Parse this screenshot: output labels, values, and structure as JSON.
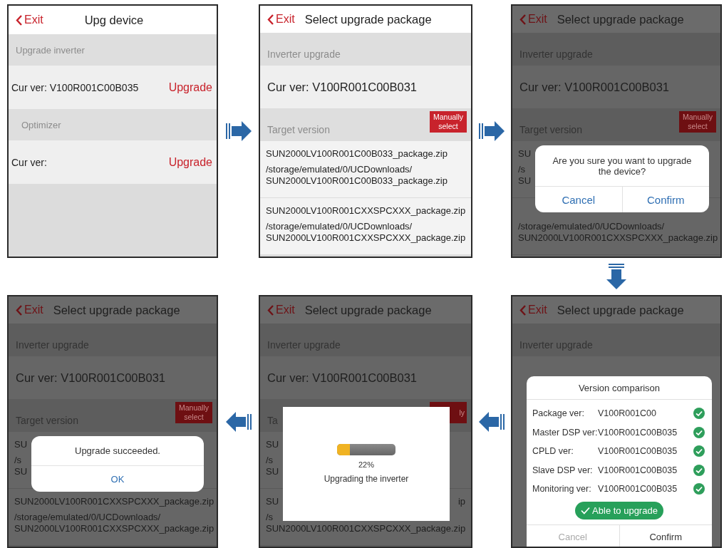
{
  "screens": [
    {
      "kind": "device",
      "dimmed": false,
      "header": {
        "back": "Exit",
        "title": "Upg device"
      },
      "items": [
        {
          "kind": "section",
          "label": "Upgrade inverter"
        },
        {
          "kind": "row",
          "text": "Cur ver: V100R001C00B035",
          "action": "Upgrade"
        },
        {
          "kind": "section",
          "label": "Optimizer",
          "indent": true
        },
        {
          "kind": "row",
          "text": "Cur ver:",
          "action": "Upgrade"
        }
      ]
    },
    {
      "kind": "package",
      "dimmed": false,
      "header": {
        "back": "Exit",
        "title": "Select upgrade package"
      },
      "items": [
        {
          "kind": "section",
          "label": "Inverter upgrade"
        },
        {
          "kind": "row",
          "text": "Cur ver:  V100R001C00B031"
        },
        {
          "kind": "section",
          "label": "Target version",
          "button": {
            "label": "Manually select"
          }
        },
        {
          "kind": "package",
          "name": "SUN2000LV100R001C00B033_package.zip",
          "path_lines": [
            "/storage/emulated/0/UCDownloads/",
            "SUN2000LV100R001C00B033_package.zip"
          ]
        },
        {
          "kind": "package",
          "name": "SUN2000LV100R001CXXSPCXXX_package.zip",
          "path_lines": [
            "/storage/emulated/0/UCDownloads/",
            "SUN2000LV100R001CXXSPCXXX_package.zip"
          ]
        }
      ]
    },
    {
      "kind": "package",
      "dimmed": true,
      "header": {
        "back": "Exit",
        "title": "Select upgrade package"
      },
      "items": [
        {
          "kind": "section",
          "label": "Inverter upgrade"
        },
        {
          "kind": "row",
          "text": "Cur ver:  V100R001C00B031"
        },
        {
          "kind": "section",
          "label": "Target version",
          "button": {
            "label": "Manually select"
          }
        },
        {
          "kind": "package",
          "name": "SU",
          "path_lines": [
            "/s",
            "SU"
          ]
        },
        {
          "kind": "package",
          "path_lines": [
            "/storage/emulated/0/UCDownloads/",
            "SUN2000LV100R001CXXSPCXXX_package.zip"
          ]
        }
      ],
      "dialog": {
        "kind": "confirm",
        "message": "Are you sure you want to upgrade the device?",
        "buttons": [
          {
            "label": "Cancel"
          },
          {
            "label": "Confirm"
          }
        ]
      }
    },
    {
      "kind": "package",
      "dimmed": true,
      "header": {
        "back": "Exit",
        "title": "Select upgrade package"
      },
      "items": [
        {
          "kind": "section",
          "label": "Inverter upgrade"
        },
        {
          "kind": "row",
          "text": "Cur ver:  V100R001C00B031"
        },
        {
          "kind": "section",
          "label": "Target version",
          "button": {
            "label": "Manually select"
          }
        },
        {
          "kind": "package",
          "name": "SU",
          "path_lines": [
            "/s",
            "SU"
          ]
        },
        {
          "kind": "package",
          "name": "SUN2000LV100R001CXXSPCXXX_package.zip",
          "path_lines": [
            "/storage/emulated/0/UCDownloads/",
            "SUN2000LV100R001CXXSPCXXX_package.zip"
          ]
        }
      ],
      "dialog": {
        "kind": "alert",
        "message": "Upgrade succeeded.",
        "buttons": [
          {
            "label": "OK"
          }
        ]
      }
    },
    {
      "kind": "package",
      "dimmed": true,
      "header": {
        "back": "Exit",
        "title": "Select upgrade package"
      },
      "items": [
        {
          "kind": "section",
          "label": "Inverter upgrade"
        },
        {
          "kind": "row",
          "text": "Cur ver:  V100R001C00B031"
        },
        {
          "kind": "section",
          "label": "Ta",
          "button": {
            "label": "ly",
            "clipped": true
          }
        },
        {
          "kind": "package",
          "name": "SU",
          "path_lines": [
            "/s",
            "SU"
          ]
        },
        {
          "kind": "package",
          "name": "SU",
          "name_end": "ip",
          "path_lines": [
            "/s",
            "SUN2000LV100R001CXXSPCXXX_package.zip"
          ]
        }
      ],
      "dialog": {
        "kind": "progress",
        "level": 0.22,
        "percent": "22%",
        "message": "Upgrading the inverter"
      }
    },
    {
      "kind": "package",
      "dimmed": true,
      "header": {
        "back": "Exit",
        "title": "Select upgrade package"
      },
      "items": [
        {
          "kind": "section",
          "label": "Inverter upgrade"
        },
        {
          "kind": "row"
        }
      ],
      "dialog": {
        "kind": "comparison",
        "title": "Version comparison",
        "rows": [
          {
            "label": "Package ver:",
            "value": "V100R001C00",
            "ok": true
          },
          {
            "label": "Master DSP ver:",
            "value": "V100R001C00B035",
            "ok": true
          },
          {
            "label": "CPLD ver:",
            "value": "V100R001C00B035",
            "ok": true
          },
          {
            "label": "Slave DSP ver:",
            "value": "V100R001C00B035",
            "ok": true
          },
          {
            "label": "Monitoring ver:",
            "value": "V100R001C00B035",
            "ok": true
          }
        ],
        "status": {
          "label": "Able to upgrade",
          "ok": true
        },
        "buttons": [
          {
            "label": "Cancel",
            "disabled": true
          },
          {
            "label": "Confirm",
            "disabled": false
          }
        ]
      }
    }
  ]
}
